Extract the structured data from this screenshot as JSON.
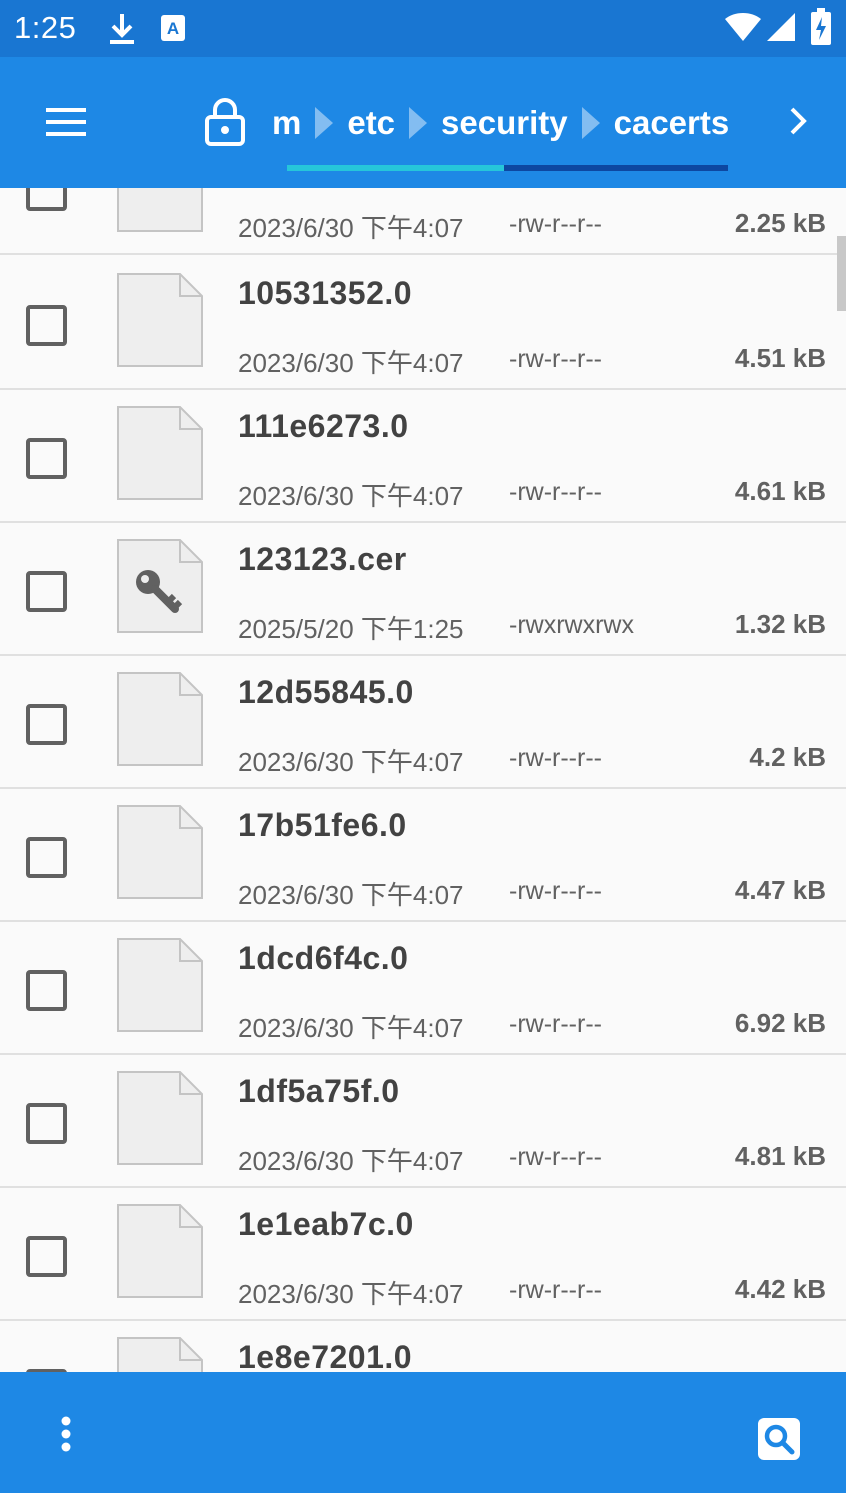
{
  "status_bar": {
    "time": "1:25",
    "icons": [
      "download-icon",
      "keyboard-a-icon",
      "wifi-icon",
      "signal-icon",
      "battery-charging-icon"
    ]
  },
  "toolbar": {
    "menu_icon": "hamburger-menu-icon",
    "lock_icon": "lock-icon",
    "breadcrumbs": [
      "m",
      "etc",
      "security",
      "cacerts"
    ],
    "next_icon": "chevron-right-icon",
    "accent_color": "#26c6da",
    "bar_color": "#1e88e5"
  },
  "files": [
    {
      "name": "",
      "date": "2023/6/30 下午4:07",
      "perm": "-rw-r--r--",
      "size": "2.25 kB",
      "icon": "file-icon"
    },
    {
      "name": "10531352.0",
      "date": "2023/6/30 下午4:07",
      "perm": "-rw-r--r--",
      "size": "4.51 kB",
      "icon": "file-icon"
    },
    {
      "name": "111e6273.0",
      "date": "2023/6/30 下午4:07",
      "perm": "-rw-r--r--",
      "size": "4.61 kB",
      "icon": "file-icon"
    },
    {
      "name": "123123.cer",
      "date": "2025/5/20 下午1:25",
      "perm": "-rwxrwxrwx",
      "size": "1.32 kB",
      "icon": "key-file-icon"
    },
    {
      "name": "12d55845.0",
      "date": "2023/6/30 下午4:07",
      "perm": "-rw-r--r--",
      "size": "4.2 kB",
      "icon": "file-icon"
    },
    {
      "name": "17b51fe6.0",
      "date": "2023/6/30 下午4:07",
      "perm": "-rw-r--r--",
      "size": "4.47 kB",
      "icon": "file-icon"
    },
    {
      "name": "1dcd6f4c.0",
      "date": "2023/6/30 下午4:07",
      "perm": "-rw-r--r--",
      "size": "6.92 kB",
      "icon": "file-icon"
    },
    {
      "name": "1df5a75f.0",
      "date": "2023/6/30 下午4:07",
      "perm": "-rw-r--r--",
      "size": "4.81 kB",
      "icon": "file-icon"
    },
    {
      "name": "1e1eab7c.0",
      "date": "2023/6/30 下午4:07",
      "perm": "-rw-r--r--",
      "size": "4.42 kB",
      "icon": "file-icon"
    },
    {
      "name": "1e8e7201.0",
      "date": "",
      "perm": "",
      "size": "",
      "icon": "file-icon"
    }
  ],
  "bottom_bar": {
    "more_icon": "more-vertical-icon",
    "search_icon": "search-icon"
  }
}
